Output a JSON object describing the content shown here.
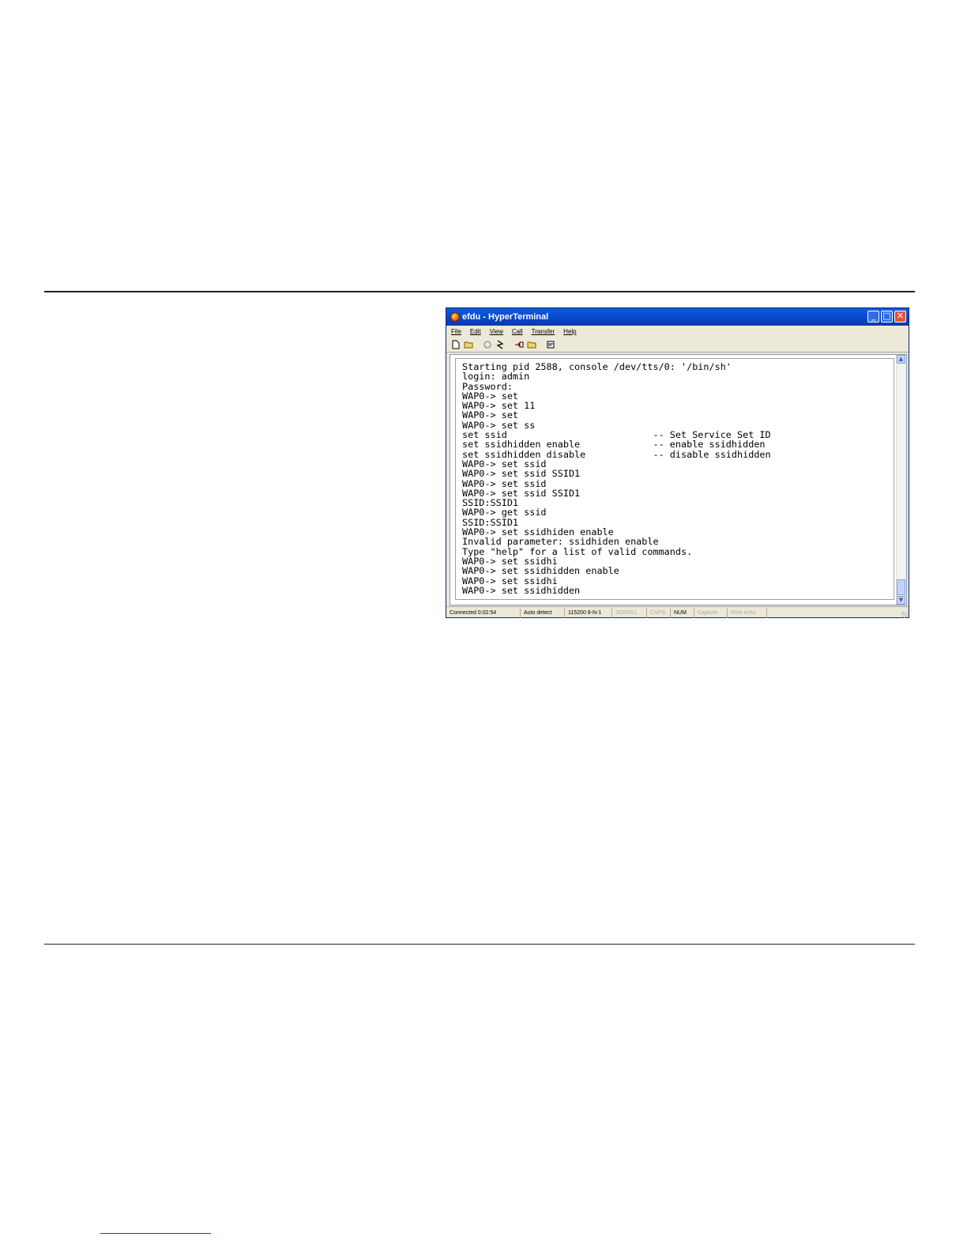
{
  "window": {
    "title": "efdu - HyperTerminal",
    "caption_buttons": {
      "minimize": "_",
      "maximize": "□",
      "close": "✕"
    }
  },
  "menu": [
    "File",
    "Edit",
    "View",
    "Call",
    "Transfer",
    "Help"
  ],
  "toolbar": [
    "new-icon",
    "open-icon",
    "disconnect-icon",
    "connect-icon",
    "send-icon",
    "receive-icon",
    "properties-icon"
  ],
  "terminal": {
    "lines": [
      "Starting pid 2588, console /dev/tts/0: '/bin/sh'",
      "login: admin",
      "Password:",
      "WAP0-> set",
      "WAP0-> set 11",
      "WAP0-> set",
      "WAP0-> set ss",
      "set ssid                          -- Set Service Set ID",
      "set ssidhidden enable             -- enable ssidhidden",
      "set ssidhidden disable            -- disable ssidhidden",
      "WAP0-> set ssid",
      "WAP0-> set ssid SSID1",
      "WAP0-> set ssid",
      "WAP0-> set ssid SSID1",
      "SSID:SSID1",
      "WAP0-> get ssid",
      "SSID:SSID1",
      "WAP0-> set ssidhiden enable",
      "Invalid parameter: ssidhiden enable",
      "Type \"help\" for a list of valid commands.",
      "WAP0-> set ssidhi",
      "WAP0-> set ssidhidden enable",
      "WAP0-> set ssidhi",
      "WAP0-> set ssidhidden"
    ]
  },
  "status": {
    "connected": "Connected 0:02:54",
    "detect": "Auto detect",
    "baud": "115200 8-N-1",
    "scroll": "SCROLL",
    "caps": "CAPS",
    "num": "NUM",
    "capture": "Capture",
    "print_echo": "Print echo"
  }
}
